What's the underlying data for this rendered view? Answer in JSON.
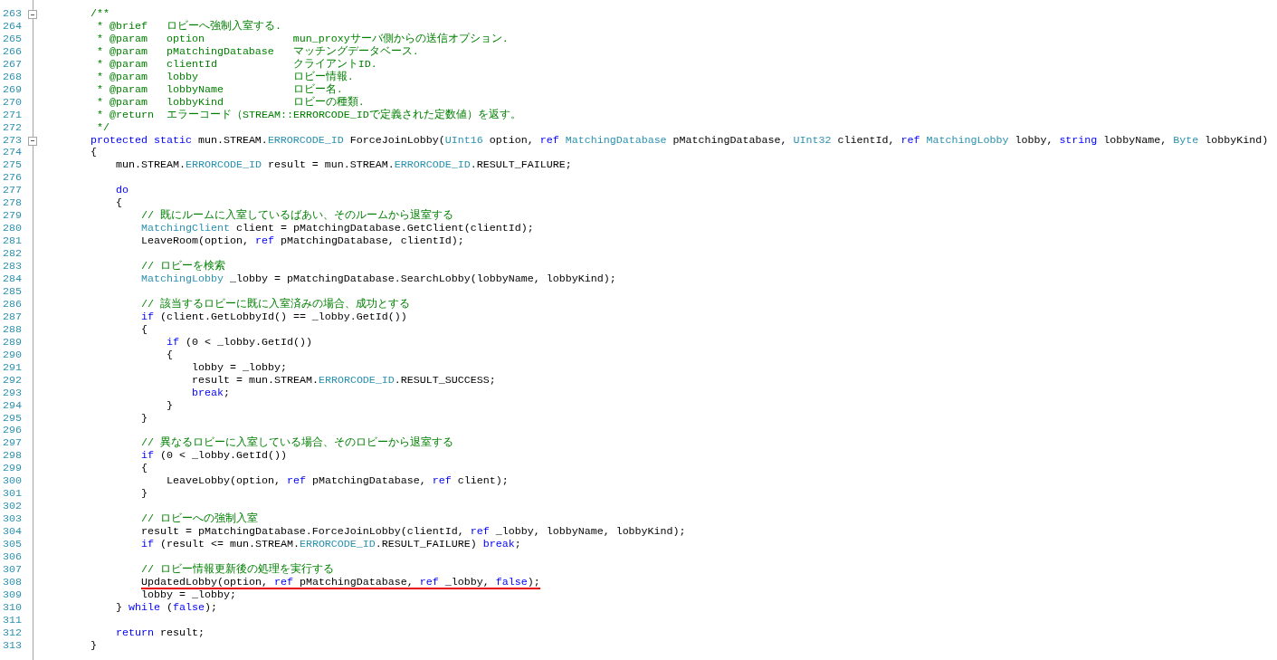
{
  "editor": {
    "lines": [
      {
        "number": "263",
        "expanded": true,
        "tokens": [
          {
            "kind": "comment",
            "text": "/**"
          }
        ]
      },
      {
        "number": "264",
        "tokens": [
          {
            "kind": "comment",
            "text": " * @brief   ロビーへ強制入室する."
          }
        ]
      },
      {
        "number": "265",
        "tokens": [
          {
            "kind": "comment",
            "text": " * @param   option              mun_proxyサーバ側からの送信オプション."
          }
        ]
      },
      {
        "number": "266",
        "tokens": [
          {
            "kind": "comment",
            "text": " * @param   pMatchingDatabase   マッチングデータベース."
          }
        ]
      },
      {
        "number": "267",
        "tokens": [
          {
            "kind": "comment",
            "text": " * @param   clientId            クライアントID."
          }
        ]
      },
      {
        "number": "268",
        "tokens": [
          {
            "kind": "comment",
            "text": " * @param   lobby               ロビー情報."
          }
        ]
      },
      {
        "number": "269",
        "tokens": [
          {
            "kind": "comment",
            "text": " * @param   lobbyName           ロビー名."
          }
        ]
      },
      {
        "number": "270",
        "tokens": [
          {
            "kind": "comment",
            "text": " * @param   lobbyKind           ロビーの種類."
          }
        ]
      },
      {
        "number": "271",
        "tokens": [
          {
            "kind": "comment",
            "text": " * @return  エラーコード（STREAM::ERRORCODE_IDで定義された定数値）を返す。"
          }
        ]
      },
      {
        "number": "272",
        "tokens": [
          {
            "kind": "comment",
            "text": " */"
          }
        ]
      },
      {
        "number": "273",
        "expanded": true,
        "tokens": [
          {
            "kind": "keyword",
            "text": "protected static"
          },
          {
            "kind": "plain",
            "text": " mun.STREAM."
          },
          {
            "kind": "type",
            "text": "ERRORCODE_ID"
          },
          {
            "kind": "plain",
            "text": " ForceJoinLobby("
          },
          {
            "kind": "type",
            "text": "UInt16"
          },
          {
            "kind": "plain",
            "text": " option, "
          },
          {
            "kind": "keyword",
            "text": "ref"
          },
          {
            "kind": "type",
            "text": " MatchingDatabase"
          },
          {
            "kind": "plain",
            "text": " pMatchingDatabase, "
          },
          {
            "kind": "type",
            "text": "UInt32"
          },
          {
            "kind": "plain",
            "text": " clientId, "
          },
          {
            "kind": "keyword",
            "text": "ref"
          },
          {
            "kind": "type",
            "text": " MatchingLobby"
          },
          {
            "kind": "plain",
            "text": " lobby, "
          },
          {
            "kind": "keyword",
            "text": "string"
          },
          {
            "kind": "plain",
            "text": " lobbyName, "
          },
          {
            "kind": "type",
            "text": "Byte"
          },
          {
            "kind": "plain",
            "text": " lobbyKind)"
          }
        ]
      },
      {
        "number": "274",
        "tokens": [
          {
            "kind": "plain",
            "text": "{"
          }
        ],
        "children": [
          {
            "number": "275",
            "tokens": [
              {
                "kind": "plain",
                "text": "mun.STREAM."
              },
              {
                "kind": "type",
                "text": "ERRORCODE_ID"
              },
              {
                "kind": "plain",
                "text": " result = mun.STREAM."
              },
              {
                "kind": "type",
                "text": "ERRORCODE_ID"
              },
              {
                "kind": "plain",
                "text": ".RESULT_FAILURE;"
              }
            ]
          },
          {
            "number": "276"
          },
          {
            "number": "277",
            "tokens": [
              {
                "kind": "keyword",
                "text": "do"
              }
            ]
          },
          {
            "number": "278",
            "tokens": [
              {
                "kind": "plain",
                "text": "{"
              }
            ],
            "children": [
              {
                "number": "279",
                "tokens": [
                  {
                    "kind": "comment",
                    "text": "// 既にルームに入室しているばあい、そのルームから退室する"
                  }
                ]
              },
              {
                "number": "280",
                "tokens": [
                  {
                    "kind": "type",
                    "text": "MatchingClient"
                  },
                  {
                    "kind": "plain",
                    "text": " client = pMatchingDatabase.GetClient(clientId);"
                  }
                ]
              },
              {
                "number": "281",
                "tokens": [
                  {
                    "kind": "plain",
                    "text": "LeaveRoom(option, "
                  },
                  {
                    "kind": "keyword",
                    "text": "ref"
                  },
                  {
                    "kind": "plain",
                    "text": " pMatchingDatabase, clientId);"
                  }
                ]
              },
              {
                "number": "282"
              },
              {
                "number": "283",
                "tokens": [
                  {
                    "kind": "comment",
                    "text": "// ロビーを検索"
                  }
                ]
              },
              {
                "number": "284",
                "tokens": [
                  {
                    "kind": "type",
                    "text": "MatchingLobby"
                  },
                  {
                    "kind": "plain",
                    "text": " _lobby = pMatchingDatabase.SearchLobby(lobbyName, lobbyKind);"
                  }
                ]
              },
              {
                "number": "285"
              },
              {
                "number": "286",
                "tokens": [
                  {
                    "kind": "comment",
                    "text": "// 該当するロビーに既に入室済みの場合、成功とする"
                  }
                ]
              },
              {
                "number": "287",
                "tokens": [
                  {
                    "kind": "keyword",
                    "text": "if"
                  },
                  {
                    "kind": "plain",
                    "text": " (client.GetLobbyId() == _lobby.GetId())"
                  }
                ]
              },
              {
                "number": "288",
                "tokens": [
                  {
                    "kind": "plain",
                    "text": "{"
                  }
                ],
                "children": [
                  {
                    "number": "289",
                    "tokens": [
                      {
                        "kind": "keyword",
                        "text": "if"
                      },
                      {
                        "kind": "plain",
                        "text": " (0 < _lobby.GetId())"
                      }
                    ]
                  },
                  {
                    "number": "290",
                    "tokens": [
                      {
                        "kind": "plain",
                        "text": "{"
                      }
                    ],
                    "children": [
                      {
                        "number": "291",
                        "tokens": [
                          {
                            "kind": "plain",
                            "text": "lobby = _lobby;"
                          }
                        ]
                      },
                      {
                        "number": "292",
                        "tokens": [
                          {
                            "kind": "plain",
                            "text": "result = mun.STREAM."
                          },
                          {
                            "kind": "type",
                            "text": "ERRORCODE_ID"
                          },
                          {
                            "kind": "plain",
                            "text": ".RESULT_SUCCESS;"
                          }
                        ]
                      },
                      {
                        "number": "293",
                        "tokens": [
                          {
                            "kind": "keyword",
                            "text": "break"
                          },
                          {
                            "kind": "plain",
                            "text": ";"
                          }
                        ]
                      }
                    ]
                  },
                  {
                    "number": "294",
                    "tokens": [
                      {
                        "kind": "plain",
                        "text": "}"
                      }
                    ]
                  }
                ]
              },
              {
                "number": "295",
                "tokens": [
                  {
                    "kind": "plain",
                    "text": "}"
                  }
                ]
              },
              {
                "number": "296"
              },
              {
                "number": "297",
                "tokens": [
                  {
                    "kind": "comment",
                    "text": "// 異なるロビーに入室している場合、そのロビーから退室する"
                  }
                ]
              },
              {
                "number": "298",
                "tokens": [
                  {
                    "kind": "keyword",
                    "text": "if"
                  },
                  {
                    "kind": "plain",
                    "text": " (0 < _lobby.GetId())"
                  }
                ]
              },
              {
                "number": "299",
                "tokens": [
                  {
                    "kind": "plain",
                    "text": "{"
                  }
                ],
                "children": [
                  {
                    "number": "300",
                    "tokens": [
                      {
                        "kind": "plain",
                        "text": "LeaveLobby(option, "
                      },
                      {
                        "kind": "keyword",
                        "text": "ref"
                      },
                      {
                        "kind": "plain",
                        "text": " pMatchingDatabase, "
                      },
                      {
                        "kind": "keyword",
                        "text": "ref"
                      },
                      {
                        "kind": "plain",
                        "text": " client);"
                      }
                    ]
                  }
                ]
              },
              {
                "number": "301",
                "tokens": [
                  {
                    "kind": "plain",
                    "text": "}"
                  }
                ]
              },
              {
                "number": "302"
              },
              {
                "number": "303",
                "tokens": [
                  {
                    "kind": "comment",
                    "text": "// ロビーへの強制入室"
                  }
                ]
              },
              {
                "number": "304",
                "tokens": [
                  {
                    "kind": "plain",
                    "text": "result = pMatchingDatabase.ForceJoinLobby(clientId, "
                  },
                  {
                    "kind": "keyword",
                    "text": "ref"
                  },
                  {
                    "kind": "plain",
                    "text": " _lobby, lobbyName, lobbyKind);"
                  }
                ]
              },
              {
                "number": "305",
                "tokens": [
                  {
                    "kind": "keyword",
                    "text": "if"
                  },
                  {
                    "kind": "plain",
                    "text": " (result <= mun.STREAM."
                  },
                  {
                    "kind": "type",
                    "text": "ERRORCODE_ID"
                  },
                  {
                    "kind": "plain",
                    "text": ".RESULT_FAILURE) "
                  },
                  {
                    "kind": "keyword",
                    "text": "break"
                  },
                  {
                    "kind": "plain",
                    "text": ";"
                  }
                ]
              },
              {
                "number": "306"
              },
              {
                "number": "307",
                "tokens": [
                  {
                    "kind": "comment",
                    "text": "// ロビー情報更新後の処理を実行する"
                  }
                ]
              },
              {
                "number": "308",
                "underlined": true,
                "tokens": [
                  {
                    "kind": "plain",
                    "text": "UpdatedLobby(option, "
                  },
                  {
                    "kind": "keyword",
                    "text": "ref"
                  },
                  {
                    "kind": "plain",
                    "text": " pMatchingDatabase, "
                  },
                  {
                    "kind": "keyword",
                    "text": "ref"
                  },
                  {
                    "kind": "plain",
                    "text": " _lobby, "
                  },
                  {
                    "kind": "keyword",
                    "text": "false"
                  },
                  {
                    "kind": "plain",
                    "text": ");"
                  }
                ]
              },
              {
                "number": "309",
                "tokens": [
                  {
                    "kind": "plain",
                    "text": "lobby = _lobby;"
                  }
                ]
              }
            ]
          },
          {
            "number": "310",
            "tokens": [
              {
                "kind": "plain",
                "text": "} "
              },
              {
                "kind": "keyword",
                "text": "while"
              },
              {
                "kind": "plain",
                "text": " ("
              },
              {
                "kind": "keyword",
                "text": "false"
              },
              {
                "kind": "plain",
                "text": ");"
              }
            ]
          },
          {
            "number": "311"
          },
          {
            "number": "312",
            "tokens": [
              {
                "kind": "keyword",
                "text": "return"
              },
              {
                "kind": "plain",
                "text": " result;"
              }
            ]
          }
        ]
      },
      {
        "number": "313",
        "tokens": [
          {
            "kind": "plain",
            "text": "}"
          }
        ]
      }
    ]
  }
}
